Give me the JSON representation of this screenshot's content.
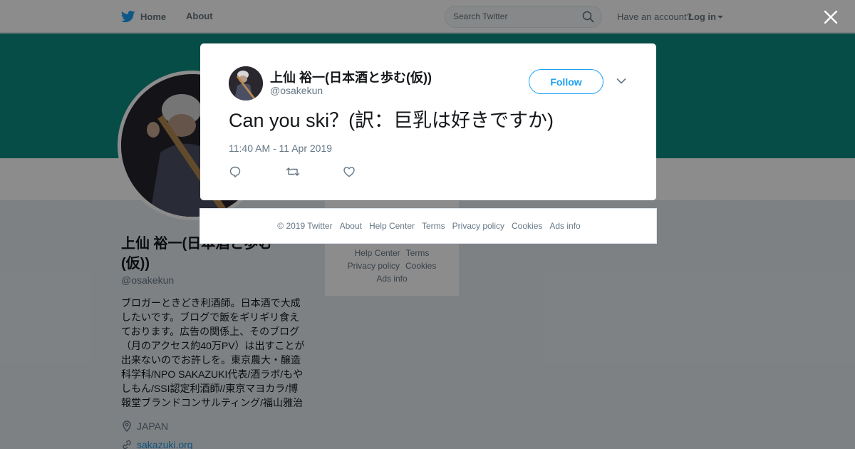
{
  "nav": {
    "home_label": "Home",
    "about_label": "About",
    "search_placeholder": "Search Twitter",
    "have_account": "Have an account?",
    "login_label": "Log in"
  },
  "profile": {
    "name": "上仙 裕一(日本酒と歩む(仮))",
    "handle": "@osakekun",
    "bio": "ブロガーときどき利酒師。日本酒で大成したいです。ブログで飯をギリギリ食えております。広告の関係上、そのブログ（月のアクセス約40万PV）は出すことが出来ないのでお許しを。東京農大・醸造科学科/NPO SAKAZUKI代表/酒ラボ/もやしもん/SSI認定利酒師//東京マヨカラ/博報堂ブランドコンサルティング/福山雅治",
    "location": "JAPAN",
    "url": "sakazuki.org"
  },
  "side_links": {
    "help_center": "Help Center",
    "terms": "Terms",
    "privacy": "Privacy policy",
    "cookies": "Cookies",
    "ads_info": "Ads info"
  },
  "tweet": {
    "author_name": "上仙 裕一(日本酒と歩む(仮))",
    "author_handle": "@osakekun",
    "follow_label": "Follow",
    "text": "Can you ski？(訳：巨乳は好きですか)",
    "timestamp": "11:40 AM - 11 Apr 2019"
  },
  "footer": {
    "copyright": "© 2019 Twitter",
    "about": "About",
    "help_center": "Help Center",
    "terms": "Terms",
    "privacy": "Privacy policy",
    "cookies": "Cookies",
    "ads_info": "Ads info"
  },
  "colors": {
    "brand": "#1da1f2",
    "banner": "#0c8a82",
    "page_bg": "#e6ecf0"
  },
  "icons": {
    "nav_logo": "twitter-bird-icon",
    "search": "search-icon",
    "close": "close-icon",
    "more": "chevron-down-icon",
    "reply": "reply-icon",
    "retweet": "retweet-icon",
    "like": "heart-icon",
    "location": "location-pin-icon",
    "link": "link-icon"
  }
}
